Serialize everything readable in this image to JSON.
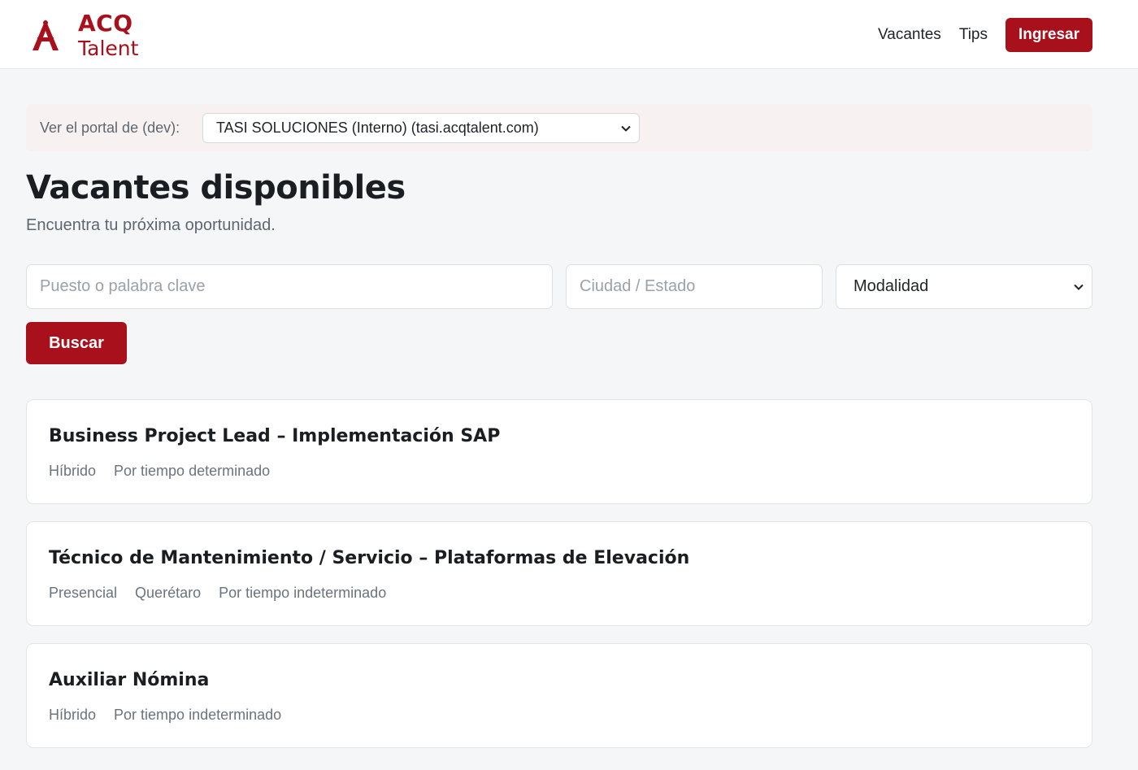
{
  "header": {
    "logo_top": "ACQ",
    "logo_bottom": "Talent",
    "nav": {
      "vacantes": "Vacantes",
      "tips": "Tips"
    },
    "login_label": "Ingresar",
    "brand_color": "#a8111c"
  },
  "portal": {
    "label": "Ver el portal de (dev):",
    "selected": "TASI SOLUCIONES (Interno) (tasi.acqtalent.com)"
  },
  "main": {
    "title": "Vacantes disponibles",
    "subtitle": "Encuentra tu próxima oportunidad."
  },
  "search": {
    "keyword_placeholder": "Puesto o palabra clave",
    "city_placeholder": "Ciudad / Estado",
    "mode_selected": "Modalidad",
    "button_label": "Buscar"
  },
  "jobs": [
    {
      "title": "Business Project Lead – Implementación SAP",
      "tags": [
        "Híbrido",
        "Por tiempo determinado"
      ]
    },
    {
      "title": "Técnico de Mantenimiento / Servicio – Plataformas de Elevación",
      "tags": [
        "Presencial",
        "Querétaro",
        "Por tiempo indeterminado"
      ]
    },
    {
      "title": "Auxiliar Nómina",
      "tags": [
        "Híbrido",
        "Por tiempo indeterminado"
      ]
    }
  ]
}
